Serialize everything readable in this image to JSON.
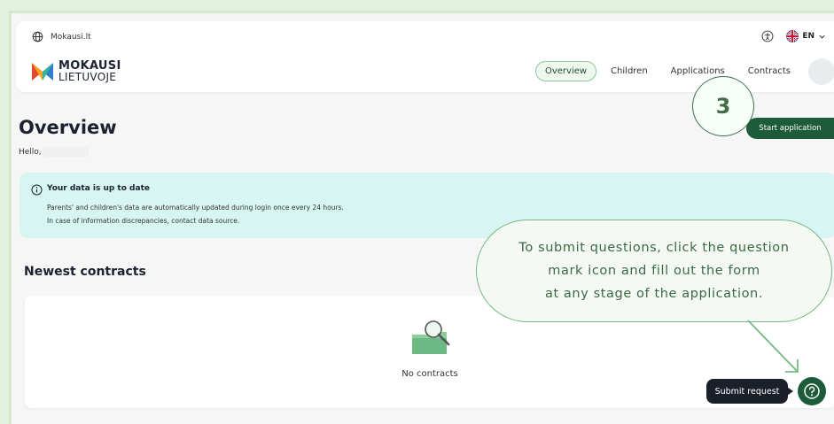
{
  "topbar": {
    "site": "Mokausi.lt",
    "language": "EN"
  },
  "logo": {
    "line1": "MOKAUSI",
    "line2": "LIETUVOJE"
  },
  "nav": {
    "items": [
      "Overview",
      "Children",
      "Applications",
      "Contracts"
    ],
    "active": "Overview"
  },
  "page": {
    "title": "Overview",
    "greeting": "Hello,",
    "start_button": "Start application"
  },
  "step_marker": "3",
  "info": {
    "title": "Your data is up to date",
    "line1": "Parents' and children's data are automatically updated during login once every 24 hours.",
    "line2": "In case of information discrepancies, contact data source."
  },
  "contracts": {
    "section_title": "Newest contracts",
    "empty_text": "No contracts"
  },
  "tooltip": {
    "line1": "To submit questions, click the question",
    "line2": "mark icon and fill out the form",
    "line3": "at any stage of the application."
  },
  "help": {
    "bubble_label": "Submit request"
  },
  "colors": {
    "brand_green": "#1e5b3a",
    "info_bg": "#d7f6f1",
    "accent": "#78b884"
  }
}
